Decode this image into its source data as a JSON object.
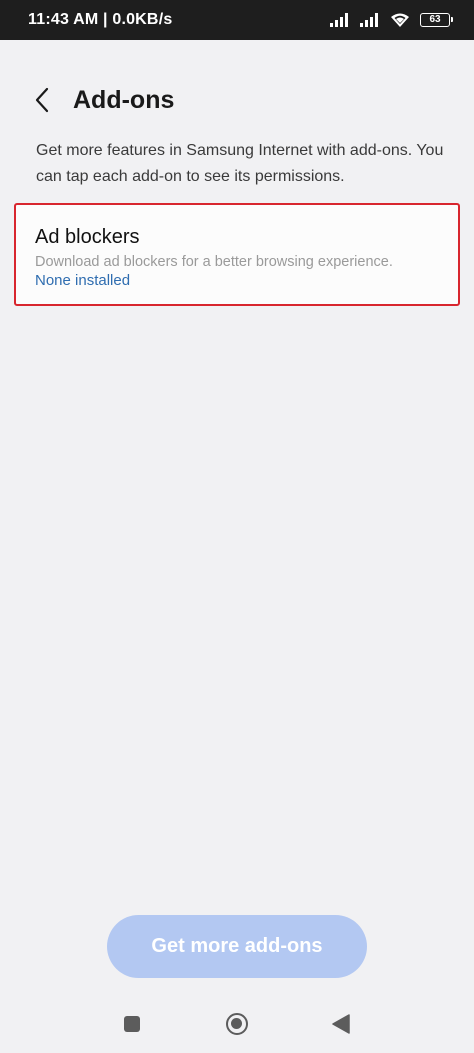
{
  "status_bar": {
    "time_speed": "11:43 AM | 0.0KB/s",
    "battery": "63",
    "icons": [
      "signal-icon",
      "signal-icon",
      "wifi-icon",
      "battery-icon"
    ]
  },
  "header": {
    "back_icon": "chevron-left-icon",
    "title": "Add-ons"
  },
  "description": "Get more features in Samsung Internet with add-ons. You can tap each add-on to see its permissions.",
  "addons": [
    {
      "title": "Ad blockers",
      "description": "Download ad blockers for a better browsing experience.",
      "status": "None installed"
    }
  ],
  "cta": {
    "label": "Get more add-ons"
  },
  "nav_bar": {
    "icons": [
      "recents-icon",
      "home-icon",
      "back-triangle-icon"
    ]
  },
  "colors": {
    "background": "#f1f1f3",
    "highlight_border": "#d8262e",
    "link_blue": "#2f6db0",
    "button_fill": "#b3c8f2",
    "status_bar": "#1e1e1e"
  }
}
